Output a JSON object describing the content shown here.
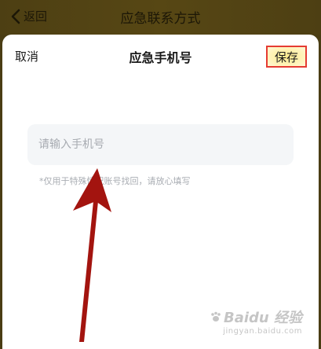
{
  "top_bar": {
    "back_label": "返回",
    "title": "应急联系方式"
  },
  "sheet": {
    "cancel_label": "取消",
    "title": "应急手机号",
    "save_label": "保存",
    "phone_input": {
      "placeholder": "请输入手机号",
      "value": ""
    },
    "hint": "*仅用于特殊情况账号找回，请放心填写"
  },
  "watermark": {
    "logo": "Baidu 经验",
    "sub": "jingyan.baidu.com"
  },
  "colors": {
    "top_bar": "#574714",
    "annotation": "#e53b32",
    "arrow": "#a3140f",
    "input_bg": "#f4f6f8"
  },
  "icons": {
    "back": "chevron-left-icon",
    "paw": "paw-icon"
  }
}
